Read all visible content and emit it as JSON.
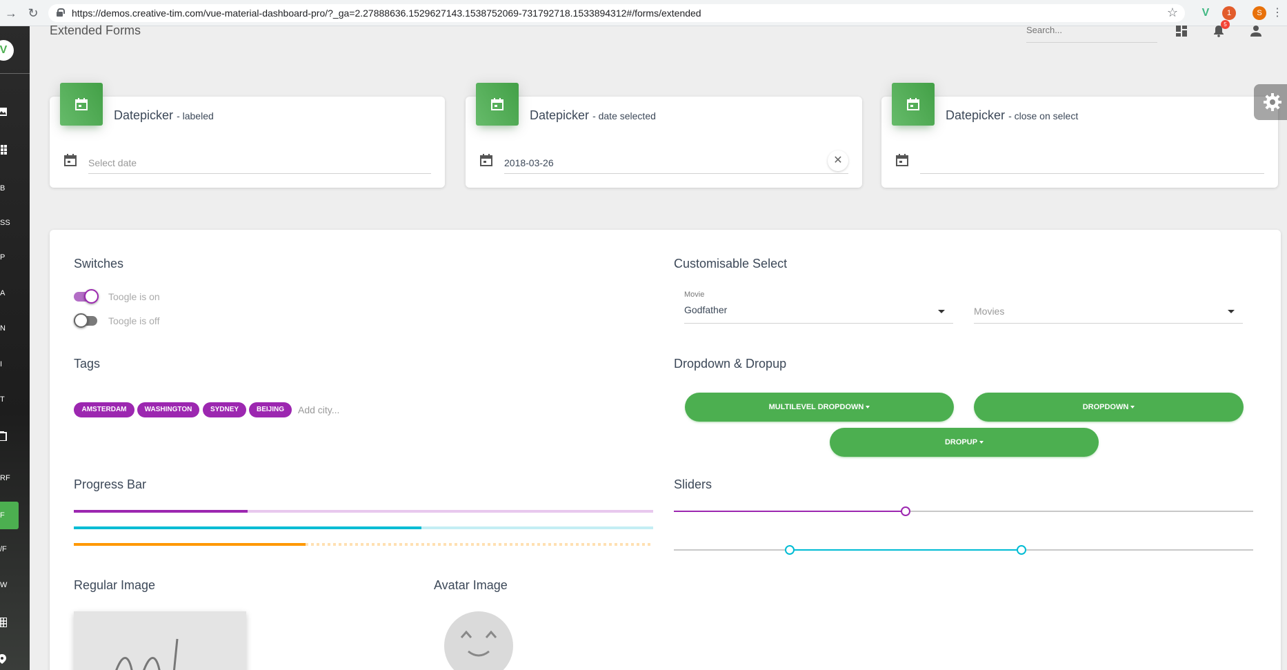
{
  "browser": {
    "url": "https://demos.creative-tim.com/vue-material-dashboard-pro/?_ga=2.27888636.1529627143.1538752069-731792718.1533894312#/forms/extended",
    "back_icon": "arrow-right-icon",
    "reload_icon": "reload-icon",
    "ext_badge": "1",
    "profile_initial": "S"
  },
  "sidebar": {
    "logo": "V",
    "items": [
      "B",
      "SS",
      "P",
      "A",
      "N",
      "I",
      "T",
      "RF",
      "F",
      "/F",
      "W"
    ]
  },
  "navbar": {
    "title": "Extended Forms",
    "search_placeholder": "Search...",
    "notification_count": "5"
  },
  "datepickers": [
    {
      "title": "Datepicker",
      "subtitle": "- labeled",
      "value": "",
      "placeholder": "Select date"
    },
    {
      "title": "Datepicker",
      "subtitle": "- date selected",
      "value": "2018-03-26",
      "placeholder": ""
    },
    {
      "title": "Datepicker",
      "subtitle": "- close on select",
      "value": "",
      "placeholder": ""
    }
  ],
  "switches": {
    "title": "Switches",
    "on_label": "Toogle is on",
    "off_label": "Toogle is off"
  },
  "tags": {
    "title": "Tags",
    "items": [
      "AMSTERDAM",
      "WASHINGTON",
      "SYDNEY",
      "BEIJING"
    ],
    "placeholder": "Add city..."
  },
  "custom_select": {
    "title": "Customisable Select",
    "first_label": "Movie",
    "first_value": "Godfather",
    "second_placeholder": "Movies"
  },
  "dropdowns": {
    "title": "Dropdown & Dropup",
    "multilevel": "MULTILEVEL DROPDOWN",
    "dropdown": "DROPDOWN",
    "dropup": "DROPUP"
  },
  "progress": {
    "title": "Progress Bar",
    "bars": [
      {
        "value": 30,
        "color": "#9c27b0"
      },
      {
        "value": 60,
        "color": "#00bcd4"
      },
      {
        "value": 40,
        "color": "#ff9800"
      }
    ]
  },
  "sliders": {
    "title": "Sliders",
    "single_value": 40,
    "range_values": [
      20,
      60
    ]
  },
  "images": {
    "regular_title": "Regular Image",
    "avatar_title": "Avatar Image"
  },
  "colors": {
    "primary": "#9c27b0",
    "success": "#4caf50",
    "info": "#00bcd4",
    "warning": "#ff9800"
  }
}
